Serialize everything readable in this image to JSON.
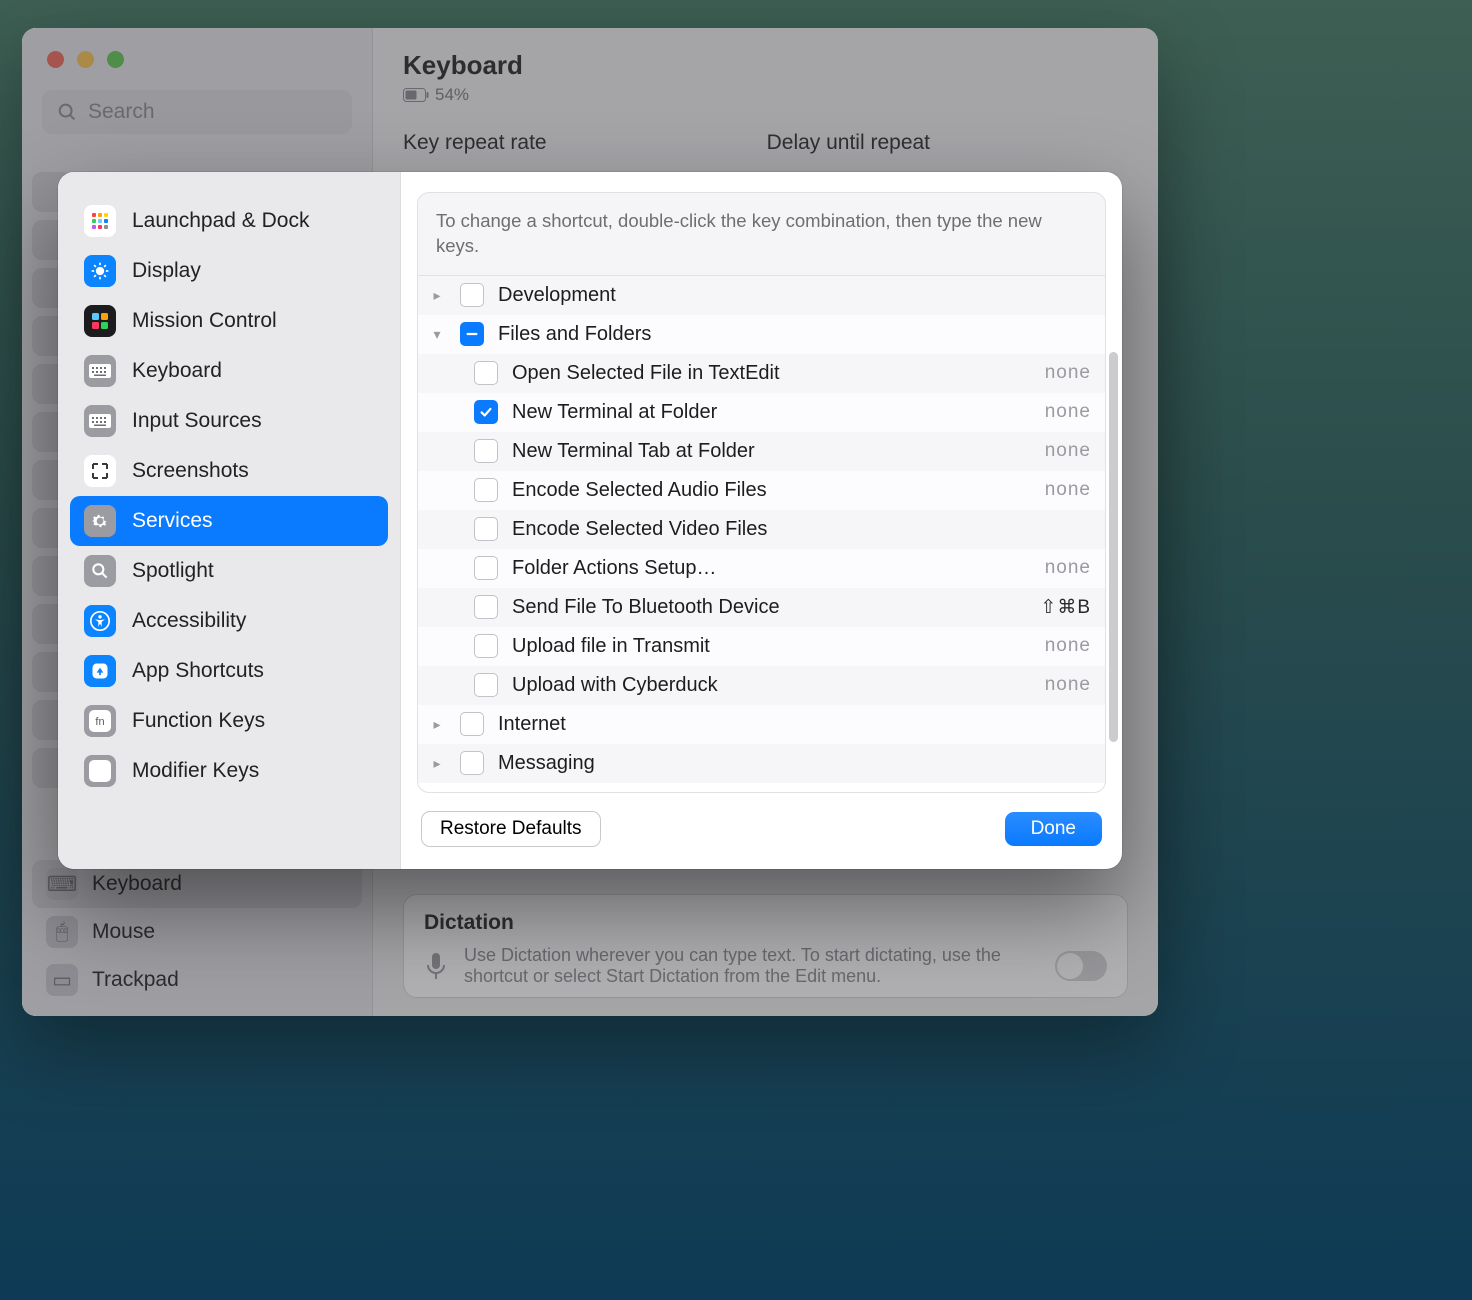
{
  "bg": {
    "title": "Keyboard",
    "battery": "54%",
    "label_repeat": "Key repeat rate",
    "label_delay": "Delay until repeat",
    "search_placeholder": "Search",
    "side_items": [
      {
        "label": "Keyboard"
      },
      {
        "label": "Mouse"
      },
      {
        "label": "Trackpad"
      }
    ],
    "dictation": {
      "title": "Dictation",
      "desc": "Use Dictation wherever you can type text. To start dictating, use the shortcut or select Start Dictation from the Edit menu."
    }
  },
  "modal": {
    "sidebar": [
      {
        "label": "Launchpad & Dock",
        "icon": "grid",
        "bg": "#ffffff",
        "fg": "#ff4f4f",
        "data_name": "sidebar-item-launchpad"
      },
      {
        "label": "Display",
        "icon": "sun",
        "bg": "#0a84ff",
        "fg": "#fff",
        "data_name": "sidebar-item-display"
      },
      {
        "label": "Mission Control",
        "icon": "mc",
        "bg": "#1c1c1e",
        "fg": "#fff",
        "data_name": "sidebar-item-mission-control"
      },
      {
        "label": "Keyboard",
        "icon": "kb",
        "bg": "#9b9ba2",
        "fg": "#fff",
        "data_name": "sidebar-item-keyboard"
      },
      {
        "label": "Input Sources",
        "icon": "kb",
        "bg": "#9b9ba2",
        "fg": "#fff",
        "data_name": "sidebar-item-input-sources"
      },
      {
        "label": "Screenshots",
        "icon": "ss",
        "bg": "#ffffff",
        "fg": "#3a3a3c",
        "data_name": "sidebar-item-screenshots"
      },
      {
        "label": "Services",
        "icon": "gears",
        "bg": "#9b9ba2",
        "fg": "#fff",
        "selected": true,
        "data_name": "sidebar-item-services"
      },
      {
        "label": "Spotlight",
        "icon": "search",
        "bg": "#9b9ba2",
        "fg": "#fff",
        "data_name": "sidebar-item-spotlight"
      },
      {
        "label": "Accessibility",
        "icon": "acc",
        "bg": "#0a84ff",
        "fg": "#fff",
        "data_name": "sidebar-item-accessibility"
      },
      {
        "label": "App Shortcuts",
        "icon": "app",
        "bg": "#0a84ff",
        "fg": "#fff",
        "data_name": "sidebar-item-app-shortcuts"
      },
      {
        "label": "Function Keys",
        "icon": "fn",
        "bg": "#9b9ba2",
        "fg": "#fff",
        "data_name": "sidebar-item-function-keys"
      },
      {
        "label": "Modifier Keys",
        "icon": "up",
        "bg": "#9b9ba2",
        "fg": "#fff",
        "data_name": "sidebar-item-modifier-keys"
      }
    ],
    "instruction": "To change a shortcut, double-click the key combination, then type the new keys.",
    "rows": [
      {
        "type": "group",
        "label": "Development",
        "expanded": false,
        "check": "off"
      },
      {
        "type": "group",
        "label": "Files and Folders",
        "expanded": true,
        "check": "minus"
      },
      {
        "type": "child",
        "label": "Open Selected File in TextEdit",
        "check": "off",
        "shortcut": "none"
      },
      {
        "type": "child",
        "label": "New Terminal at Folder",
        "check": "on",
        "shortcut": "none"
      },
      {
        "type": "child",
        "label": "New Terminal Tab at Folder",
        "check": "off",
        "shortcut": "none"
      },
      {
        "type": "child",
        "label": "Encode Selected Audio Files",
        "check": "off",
        "shortcut": "none"
      },
      {
        "type": "child",
        "label": "Encode Selected Video Files",
        "check": "off",
        "shortcut": ""
      },
      {
        "type": "child",
        "label": "Folder Actions Setup…",
        "check": "off",
        "shortcut": "none"
      },
      {
        "type": "child",
        "label": "Send File To Bluetooth Device",
        "check": "off",
        "shortcut": "⇧⌘B"
      },
      {
        "type": "child",
        "label": "Upload file in Transmit",
        "check": "off",
        "shortcut": "none"
      },
      {
        "type": "child",
        "label": "Upload with Cyberduck",
        "check": "off",
        "shortcut": "none"
      },
      {
        "type": "group",
        "label": "Internet",
        "expanded": false,
        "check": "off"
      },
      {
        "type": "group",
        "label": "Messaging",
        "expanded": false,
        "check": "off"
      }
    ],
    "restore": "Restore Defaults",
    "done": "Done"
  }
}
